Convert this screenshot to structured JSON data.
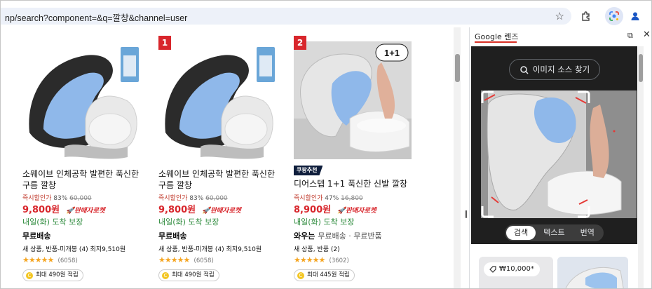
{
  "browser": {
    "url": "np/search?component=&q=깔창&channel=user"
  },
  "products": [
    {
      "rank": "",
      "title": "소웨이브 인체공학 발편한 푹신한 구름 깔창",
      "discount_label": "즉시할인가",
      "discount_pct": "83%",
      "original_price": "60,000",
      "price": "9,800원",
      "rocket": "판매자로켓",
      "delivery": "내일(화) 도착 보장",
      "shipping": "무료배송",
      "shipping_extra": "",
      "stock": "새 상품, 반품-미개봉 (4) 최저9,510원",
      "stars": "★★★★★",
      "review_count": "(6058)",
      "point": "최대 490원 적립"
    },
    {
      "rank": "1",
      "title": "소웨이브 인체공학 발편한 푹신한 구름 깔창",
      "discount_label": "즉시할인가",
      "discount_pct": "83%",
      "original_price": "60,000",
      "price": "9,800원",
      "rocket": "판매자로켓",
      "delivery": "내일(화) 도착 보장",
      "shipping": "무료배송",
      "shipping_extra": "",
      "stock": "새 상품, 반품-미개봉 (4) 최저9,510원",
      "stars": "★★★★★",
      "review_count": "(6058)",
      "point": "최대 490원 적립"
    },
    {
      "rank": "2",
      "badge": "쿠팡추천",
      "image_tag": "1+1",
      "title": "디어스텝 1+1 푹신한 신발 깔창",
      "discount_label": "즉시할인가",
      "discount_pct": "47%",
      "original_price": "16,800",
      "price": "8,900원",
      "rocket": "판매자로켓",
      "delivery": "내일(화) 도착 보장",
      "shipping": "와우는",
      "shipping_extra": "무료배송 · 무료반품",
      "stock": "새 상품, 반품 (2)",
      "stars": "★★★★★",
      "review_count": "(3602)",
      "point": "최대 445원 적립"
    }
  ],
  "side_panel": {
    "title": "Google 렌즈",
    "source_button": "이미지 소스 찾기",
    "tabs": [
      "검색",
      "텍스트",
      "번역"
    ],
    "active_tab": "검색",
    "result_price": "₩10,000*"
  },
  "colors": {
    "accent_red": "#d8262c",
    "delivery_green": "#2e8b3d",
    "lens_dark": "#1f1f1f"
  }
}
